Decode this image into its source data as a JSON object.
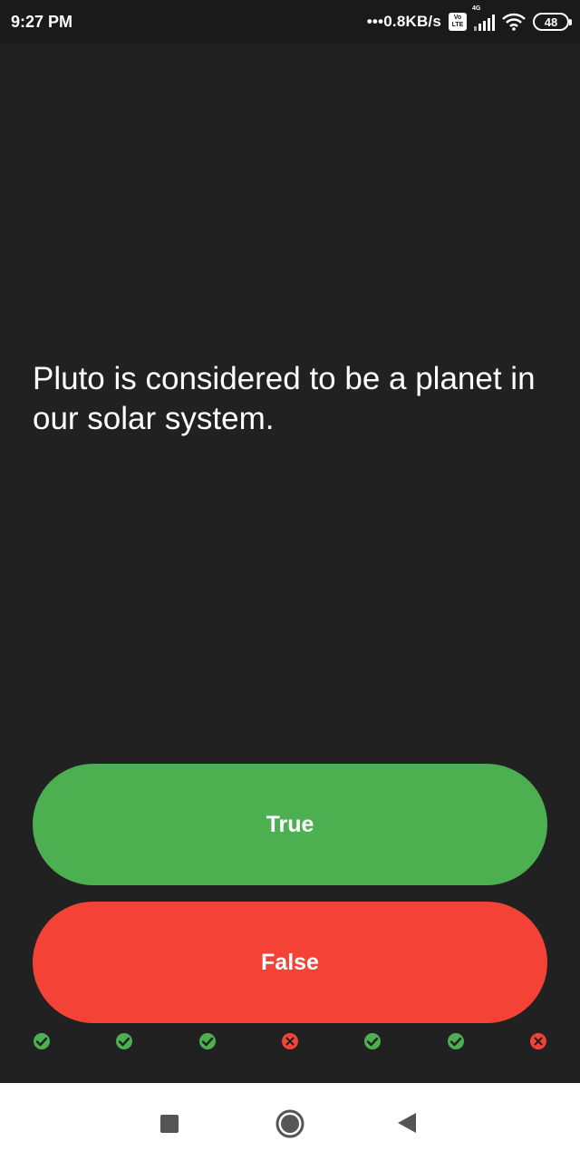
{
  "status_bar": {
    "time": "9:27 PM",
    "net_speed": "•••0.8KB/s",
    "volte_top": "Vo",
    "volte_bottom": "LTE",
    "network_type": "4G",
    "battery": "48"
  },
  "quiz": {
    "question": "Pluto is considered to be a planet in our solar system.",
    "true_label": "True",
    "false_label": "False",
    "true_color": "#4caf50",
    "false_color": "#f44336",
    "background": "#212121",
    "score_keeper": [
      "check-icon",
      "check-icon",
      "check-icon",
      "cross-icon",
      "check-icon",
      "check-icon",
      "cross-icon"
    ]
  },
  "nav": {
    "recent": "recent-apps-icon",
    "home": "home-icon",
    "back": "back-icon"
  }
}
